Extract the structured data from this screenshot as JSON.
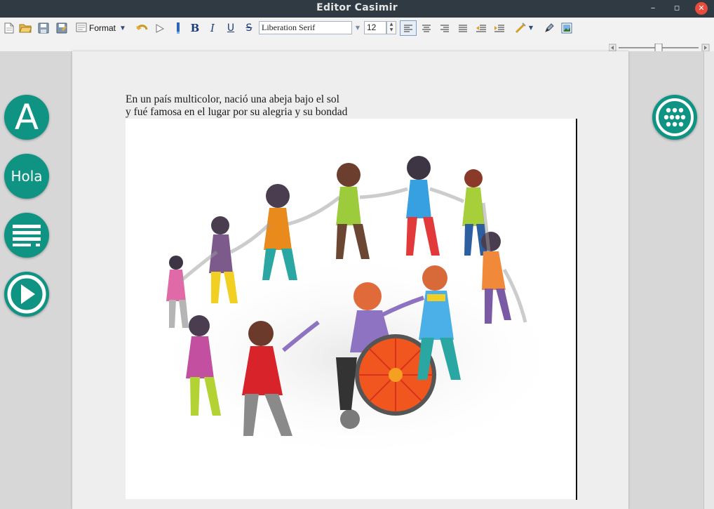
{
  "window": {
    "title": "Editor Casimir"
  },
  "toolbar": {
    "format_label": "Format",
    "font_name": "Liberation Serif",
    "font_size": "12",
    "paragraph_style": "Standard"
  },
  "document": {
    "lines": [
      "En un país multicolor, nació una abeja bajo el sol",
      "y fué famosa en el lugar por su alegria y su bondad"
    ]
  },
  "sidebar": {
    "font_button_label": "A",
    "speak_button_label": "Hola"
  },
  "zoom": {
    "level": 0.5
  },
  "colors": {
    "accent": "#0f9484",
    "titlebar": "#2f3a42"
  }
}
